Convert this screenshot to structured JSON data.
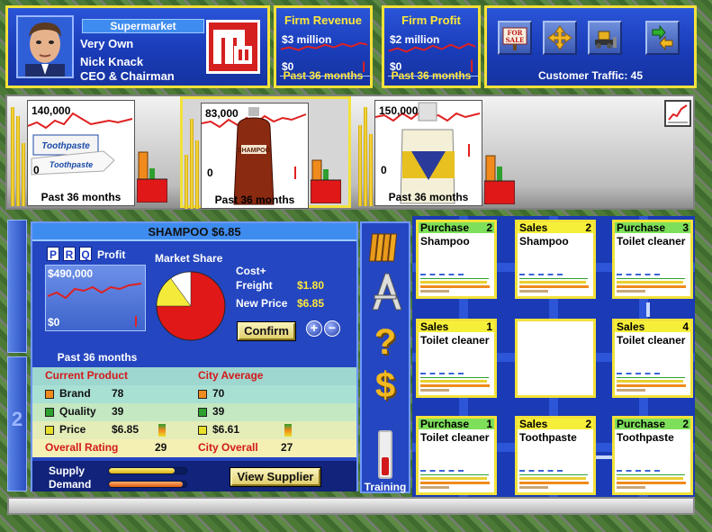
{
  "header": {
    "firm_type": "Supermarket",
    "firm_name": "Very Own",
    "ceo_name": "Nick Knack",
    "ceo_title": "CEO & Chairman"
  },
  "firm_revenue": {
    "title": "Firm Revenue",
    "value": "$3 million",
    "zero": "$0",
    "footer": "Past 36 months"
  },
  "firm_profit": {
    "title": "Firm Profit",
    "value": "$2 million",
    "zero": "$0",
    "footer": "Past 36 months"
  },
  "tools": {
    "items": [
      "for-sale",
      "move",
      "bulldoze",
      "relocate"
    ],
    "for_sale_label": "FOR SALE",
    "traffic": "Customer Traffic: 45"
  },
  "products": [
    {
      "top": "140,000",
      "zero": "0",
      "footer": "Past 36 months",
      "item": "Toothpaste",
      "bar_levels": [
        0.85,
        0.45,
        0.25
      ]
    },
    {
      "top": "83,000",
      "zero": "0",
      "footer": "Past 36 months",
      "item": "Shampoo",
      "bar_levels": [
        0.35,
        0.55,
        0.35
      ]
    },
    {
      "top": "150,000",
      "zero": "0",
      "footer": "Past 36 months",
      "item": "Toilet cleaner",
      "bar_levels": [
        0.55,
        0.4,
        0.25
      ]
    }
  ],
  "details": {
    "title": "SHAMPOO     $6.85",
    "prq": [
      "P",
      "R",
      "Q"
    ],
    "profit_label": "Profit",
    "profit_value": "$490,000",
    "profit_zero": "$0",
    "profit_footer": "Past 36 months",
    "market_share_label": "Market Share",
    "market_share": {
      "red": 0.75,
      "yellow": 0.15,
      "white": 0.1
    },
    "cost_label": "Cost+",
    "freight_label": "Freight",
    "freight_value": "$1.80",
    "new_price_label": "New Price",
    "new_price_value": "$6.85",
    "confirm_label": "Confirm",
    "plus": "+",
    "minus": "−"
  },
  "comparison": {
    "current_header": "Current Product",
    "city_header": "City Average",
    "rows": [
      {
        "label": "Brand",
        "current": "78",
        "city": "70",
        "color": "#f08a1c"
      },
      {
        "label": "Quality",
        "current": "39",
        "city": "39",
        "color": "#2fa02f"
      },
      {
        "label": "Price",
        "current": "$6.85",
        "city": "$6.61",
        "color": "#e8e028"
      }
    ],
    "overall_label": "Overall Rating",
    "overall_value": "29",
    "city_overall_label": "City Overall",
    "city_overall_value": "27"
  },
  "supply_demand": {
    "supply_label": "Supply",
    "demand_label": "Demand",
    "supply_level": 0.85,
    "demand_level": 0.95,
    "view_supplier_label": "View Supplier"
  },
  "tool_column": {
    "help": "?",
    "money": "$",
    "training_label": "Training"
  },
  "units": [
    {
      "type": "Purchase",
      "num": "2",
      "name": "Shampoo",
      "head_color": "#7ee05a"
    },
    {
      "type": "Sales",
      "num": "2",
      "name": "Shampoo",
      "head_color": "#f6ef3a"
    },
    {
      "type": "Purchase",
      "num": "3",
      "name": "Toilet cleaner",
      "head_color": "#7ee05a"
    },
    {
      "type": "Sales",
      "num": "1",
      "name": "Toilet cleaner",
      "head_color": "#f6ef3a"
    },
    {
      "type": "",
      "num": "",
      "name": "",
      "head_color": "#ffffff"
    },
    {
      "type": "Sales",
      "num": "4",
      "name": "Toilet cleaner",
      "head_color": "#f6ef3a"
    },
    {
      "type": "Purchase",
      "num": "1",
      "name": "Toilet cleaner",
      "head_color": "#7ee05a"
    },
    {
      "type": "Sales",
      "num": "2",
      "name": "Toothpaste",
      "head_color": "#f6ef3a"
    },
    {
      "type": "Purchase",
      "num": "2",
      "name": "Toothpaste",
      "head_color": "#7ee05a"
    }
  ]
}
